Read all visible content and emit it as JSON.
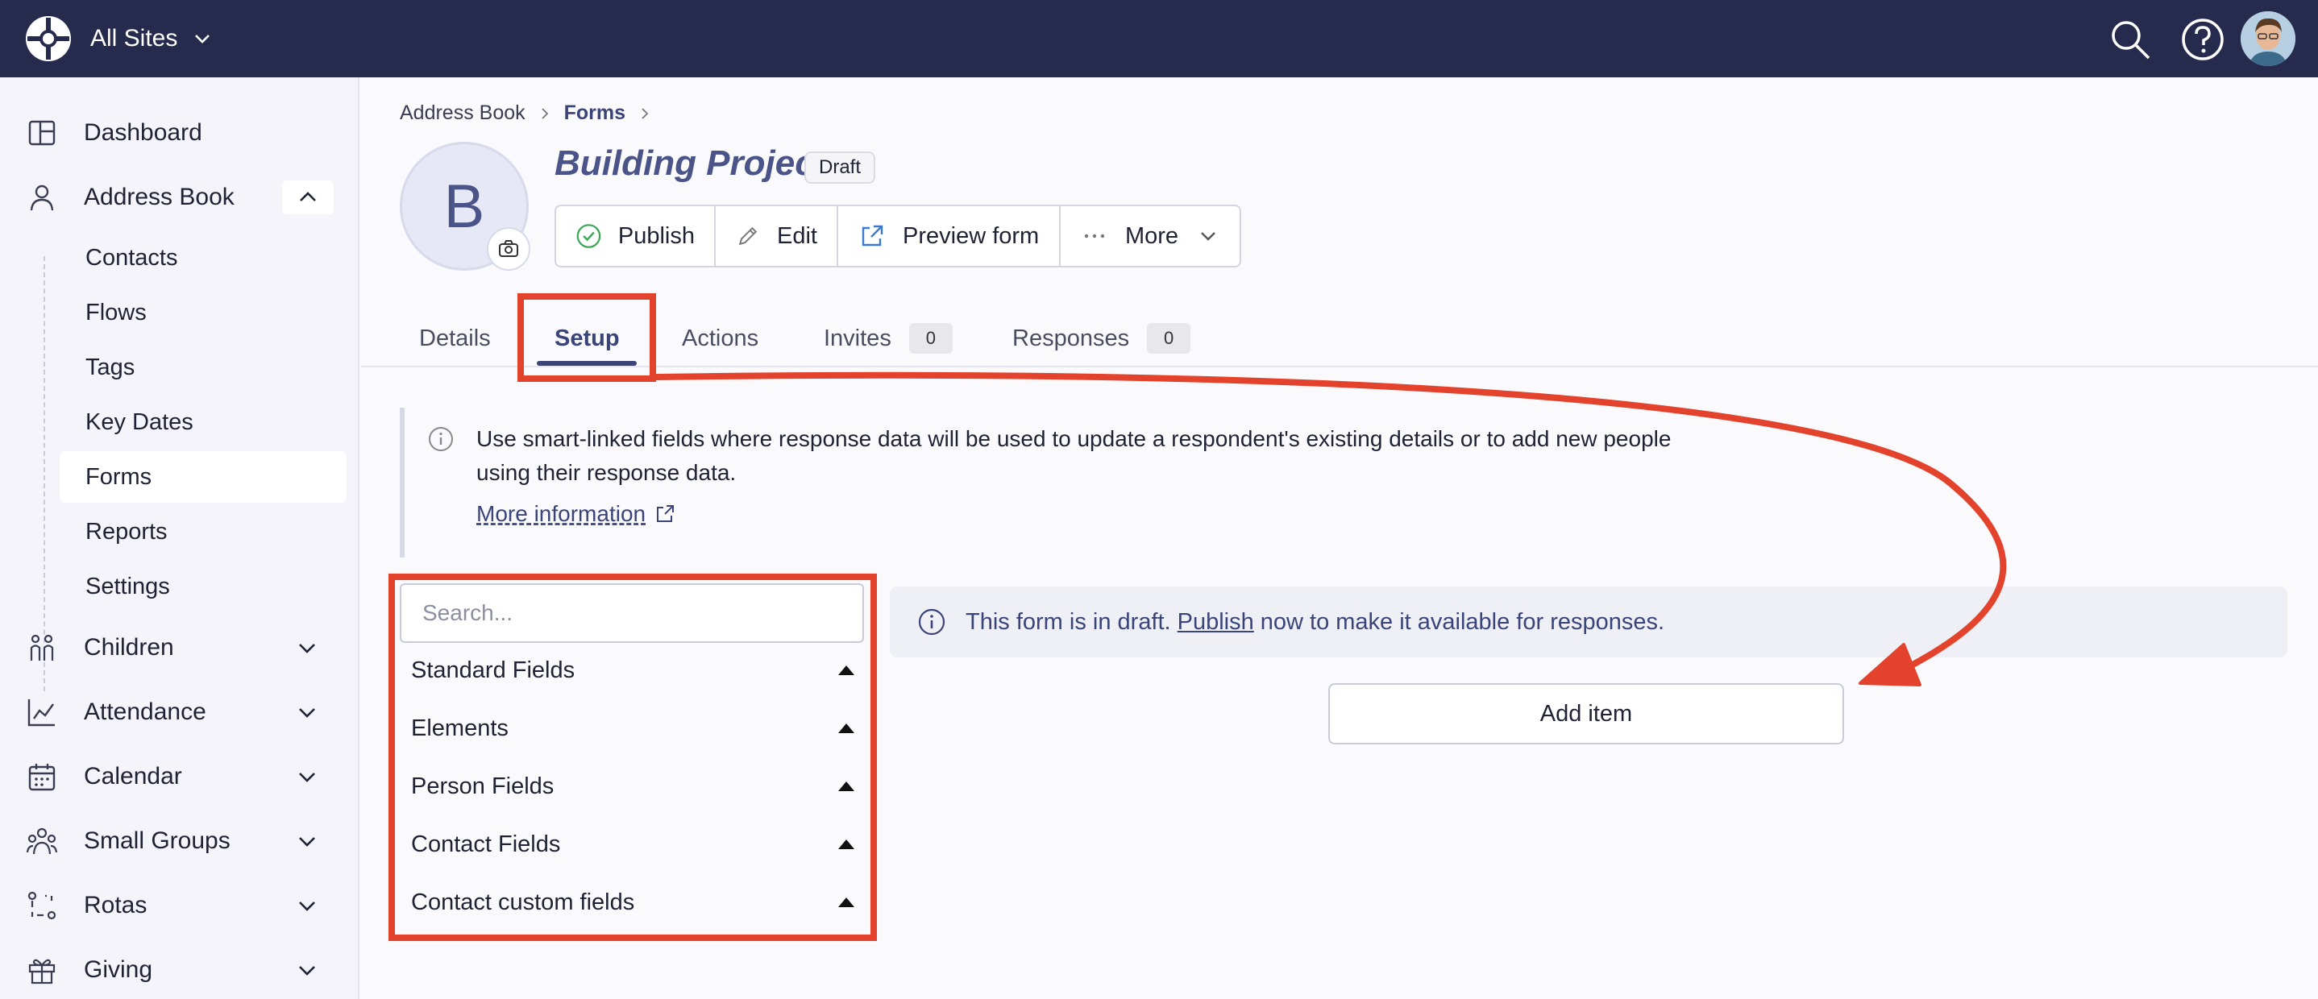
{
  "topbar": {
    "site_selector": "All Sites"
  },
  "sidebar": {
    "items": [
      {
        "label": "Dashboard",
        "icon": "dashboard-icon"
      },
      {
        "label": "Address Book",
        "icon": "person-icon"
      },
      {
        "label": "Children",
        "icon": "children-icon"
      },
      {
        "label": "Attendance",
        "icon": "chart-icon"
      },
      {
        "label": "Calendar",
        "icon": "calendar-icon"
      },
      {
        "label": "Small Groups",
        "icon": "group-icon"
      },
      {
        "label": "Rotas",
        "icon": "rota-icon"
      },
      {
        "label": "Giving",
        "icon": "gift-icon"
      }
    ],
    "sub_items": [
      "Contacts",
      "Flows",
      "Tags",
      "Key Dates",
      "Forms",
      "Reports",
      "Settings"
    ],
    "active_sub": "Forms"
  },
  "breadcrumb": {
    "root": "Address Book",
    "current": "Forms"
  },
  "form": {
    "avatar_letter": "B",
    "title": "Building Project",
    "status": "Draft"
  },
  "actions": {
    "publish": "Publish",
    "edit": "Edit",
    "preview": "Preview form",
    "more": "More"
  },
  "tabs": {
    "details": "Details",
    "setup": "Setup",
    "actions": "Actions",
    "invites": "Invites",
    "invites_count": "0",
    "responses": "Responses",
    "responses_count": "0"
  },
  "info": {
    "text": "Use smart-linked fields where response data will be used to update a respondent's existing details or to add new people using their response data.",
    "link": "More information"
  },
  "fields_panel": {
    "search_placeholder": "Search...",
    "groups": [
      "Standard Fields",
      "Elements",
      "Person Fields",
      "Contact Fields",
      "Contact custom fields"
    ]
  },
  "draft_alert": {
    "prefix": "This form is in draft.",
    "link": "Publish",
    "suffix": "now to make it available for responses."
  },
  "add_item_label": "Add item",
  "colors": {
    "topbar": "#262b4d",
    "accent": "#3a4479",
    "annotation": "#e3432c"
  }
}
